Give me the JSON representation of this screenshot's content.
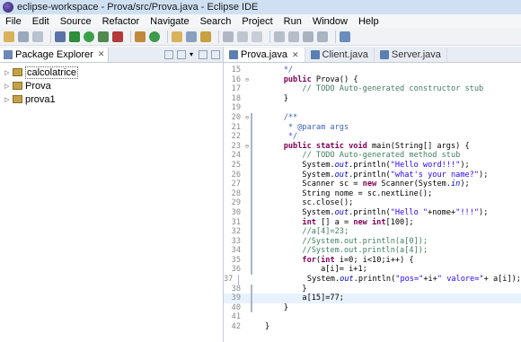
{
  "window": {
    "title": "eclipse-workspace - Prova/src/Prova.java - Eclipse IDE"
  },
  "menu": [
    "File",
    "Edit",
    "Source",
    "Refactor",
    "Navigate",
    "Search",
    "Project",
    "Run",
    "Window",
    "Help"
  ],
  "package_explorer": {
    "tab_label": "Package Explorer",
    "projects": [
      "calcolatrice",
      "Prova",
      "prova1"
    ]
  },
  "editor": {
    "tabs": [
      "Prova.java",
      "Client.java",
      "Server.java"
    ],
    "lines": [
      {
        "n": "15",
        "fold": "",
        "code": [
          [
            "jd",
            "    */"
          ]
        ]
      },
      {
        "n": "16",
        "fold": "⊖",
        "code": [
          [
            "kw",
            "    public "
          ],
          [
            "",
            "Prova() {"
          ]
        ]
      },
      {
        "n": "17",
        "fold": "",
        "code": [
          [
            "cm",
            "        // TODO Auto-generated constructor stub"
          ]
        ]
      },
      {
        "n": "18",
        "fold": "",
        "code": [
          [
            "",
            "    }"
          ]
        ]
      },
      {
        "n": "19",
        "fold": "",
        "code": [
          [
            "",
            ""
          ]
        ]
      },
      {
        "n": "20",
        "fold": "⊖",
        "code": [
          [
            "jd",
            "    /**"
          ]
        ]
      },
      {
        "n": "21",
        "fold": "",
        "code": [
          [
            "jd",
            "     * @param args"
          ]
        ]
      },
      {
        "n": "22",
        "fold": "",
        "code": [
          [
            "jd",
            "     */"
          ]
        ]
      },
      {
        "n": "23",
        "fold": "⊖",
        "code": [
          [
            "kw",
            "    public static void "
          ],
          [
            "",
            "main(String[] args) {"
          ]
        ]
      },
      {
        "n": "24",
        "fold": "",
        "code": [
          [
            "cm",
            "        // TODO Auto-generated method stub"
          ]
        ]
      },
      {
        "n": "25",
        "fold": "",
        "code": [
          [
            "",
            "        System."
          ],
          [
            "fld",
            "out"
          ],
          [
            "",
            ".println("
          ],
          [
            "st",
            "\"Hello word!!!\""
          ],
          [
            "",
            ");"
          ]
        ]
      },
      {
        "n": "26",
        "fold": "",
        "code": [
          [
            "",
            "        System."
          ],
          [
            "fld",
            "out"
          ],
          [
            "",
            ".println("
          ],
          [
            "st",
            "\"what's your name?\""
          ],
          [
            "",
            ");"
          ]
        ]
      },
      {
        "n": "27",
        "fold": "",
        "code": [
          [
            "",
            "        Scanner sc = "
          ],
          [
            "kw",
            "new "
          ],
          [
            "",
            "Scanner(System."
          ],
          [
            "fld",
            "in"
          ],
          [
            "",
            ");"
          ]
        ]
      },
      {
        "n": "28",
        "fold": "",
        "code": [
          [
            "",
            "        String nome = sc.nextLine();"
          ]
        ]
      },
      {
        "n": "29",
        "fold": "",
        "code": [
          [
            "",
            "        sc.close();"
          ]
        ]
      },
      {
        "n": "30",
        "fold": "",
        "code": [
          [
            "",
            "        System."
          ],
          [
            "fld",
            "out"
          ],
          [
            "",
            ".println("
          ],
          [
            "st",
            "\"Hello \""
          ],
          [
            "",
            "+nome+"
          ],
          [
            "st",
            "\"!!!\""
          ],
          [
            "",
            ");"
          ]
        ]
      },
      {
        "n": "31",
        "fold": "",
        "code": [
          [
            "kw",
            "        int "
          ],
          [
            "",
            "[] a = "
          ],
          [
            "kw",
            "new int"
          ],
          [
            "",
            "[100];"
          ]
        ]
      },
      {
        "n": "32",
        "fold": "",
        "code": [
          [
            "cm",
            "        //a[4]=23;"
          ]
        ]
      },
      {
        "n": "33",
        "fold": "",
        "code": [
          [
            "cm",
            "        //System.out.println(a[0]);"
          ]
        ]
      },
      {
        "n": "34",
        "fold": "",
        "code": [
          [
            "cm",
            "        //System.out.println(a[4]);"
          ]
        ]
      },
      {
        "n": "35",
        "fold": "",
        "code": [
          [
            "kw",
            "        for"
          ],
          [
            "",
            "("
          ],
          [
            "kw",
            "int "
          ],
          [
            "",
            "i=0; i<10;i++) {"
          ]
        ]
      },
      {
        "n": "36",
        "fold": "",
        "code": [
          [
            "",
            "            a[i]= i+1;"
          ]
        ]
      },
      {
        "n": "37",
        "fold": "",
        "code": [
          [
            "",
            "            System."
          ],
          [
            "fld",
            "out"
          ],
          [
            "",
            ".println("
          ],
          [
            "st",
            "\"pos=\""
          ],
          [
            "",
            "+i+"
          ],
          [
            "st",
            "\" valore=\""
          ],
          [
            "",
            "+ a[i]);"
          ]
        ]
      },
      {
        "n": "38",
        "fold": "",
        "code": [
          [
            "",
            "        }"
          ]
        ]
      },
      {
        "n": "39",
        "fold": "",
        "code": [
          [
            "",
            "        a[15]=77;"
          ]
        ]
      },
      {
        "n": "40",
        "fold": "",
        "code": [
          [
            "",
            "    }"
          ]
        ]
      },
      {
        "n": "41",
        "fold": "",
        "code": [
          [
            "",
            ""
          ]
        ]
      },
      {
        "n": "42",
        "fold": "",
        "code": [
          [
            "",
            "}"
          ]
        ]
      }
    ],
    "highlight_line": "39"
  },
  "colors": {
    "keyword": "#7f0055",
    "comment": "#3f7f5f",
    "javadoc": "#3f5fbf",
    "string": "#2a00ff",
    "field": "#0000c0"
  }
}
